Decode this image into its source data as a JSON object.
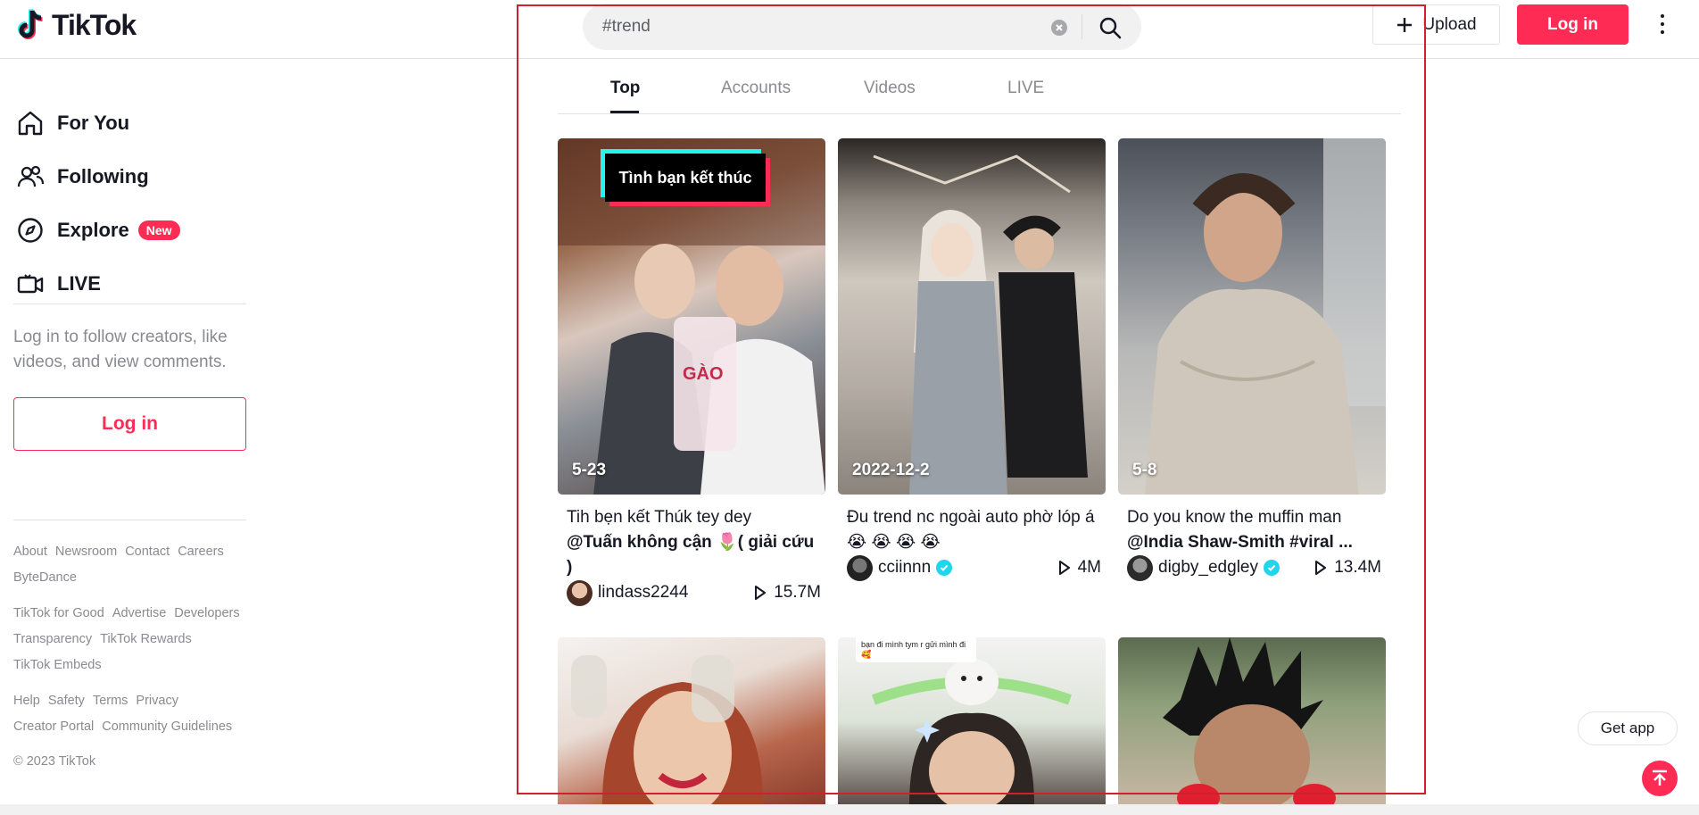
{
  "header": {
    "logo_text": "TikTok",
    "search_value": "#trend",
    "upload_label": "Upload",
    "login_label": "Log in"
  },
  "sidebar": {
    "nav": [
      {
        "label": "For You",
        "icon": "home-icon"
      },
      {
        "label": "Following",
        "icon": "users-icon"
      },
      {
        "label": "Explore",
        "icon": "compass-icon",
        "badge": "New"
      },
      {
        "label": "LIVE",
        "icon": "live-camera-icon"
      }
    ],
    "login_hint": "Log in to follow creators, like videos, and view comments.",
    "login_label": "Log in",
    "footer": {
      "row1": [
        "About",
        "Newsroom",
        "Contact",
        "Careers"
      ],
      "row2": [
        "ByteDance"
      ],
      "row3": [
        "TikTok for Good",
        "Advertise",
        "Developers"
      ],
      "row4": [
        "Transparency",
        "TikTok Rewards"
      ],
      "row5": [
        "TikTok Embeds"
      ],
      "row6": [
        "Help",
        "Safety",
        "Terms",
        "Privacy"
      ],
      "row7": [
        "Creator Portal",
        "Community Guidelines"
      ],
      "copyright": "© 2023 TikTok"
    }
  },
  "tabs": [
    "Top",
    "Accounts",
    "Videos",
    "LIVE"
  ],
  "videos": [
    {
      "date": "5-23",
      "overlay_text": "Tình bạn kết thúc",
      "caption_line1": "Tih bẹn kết Thúk tey dey",
      "caption_bold": "@Tuấn không cận 🌷( giải cứu )",
      "author": "lindass2244",
      "verified": false,
      "views": "15.7M"
    },
    {
      "date": "2022-12-2",
      "caption_line1": "Đu trend nc ngoài auto phờ lóp á 😭 😭 😭 😭",
      "caption_bold": "",
      "author": "cciinnn",
      "verified": true,
      "views": "4M"
    },
    {
      "date": "5-8",
      "caption_line1": "Do you know the muffin man",
      "caption_bold": "@India Shaw-Smith #viral ...",
      "author": "digby_edgley",
      "verified": true,
      "views": "13.4M"
    }
  ],
  "row2_overlay": "bạn đi mình tym r gửi mình đi 🥰",
  "get_app": "Get app",
  "colors": {
    "brand": "#fe2c55",
    "cyan": "#25f4ee",
    "verified": "#20d5ec"
  }
}
